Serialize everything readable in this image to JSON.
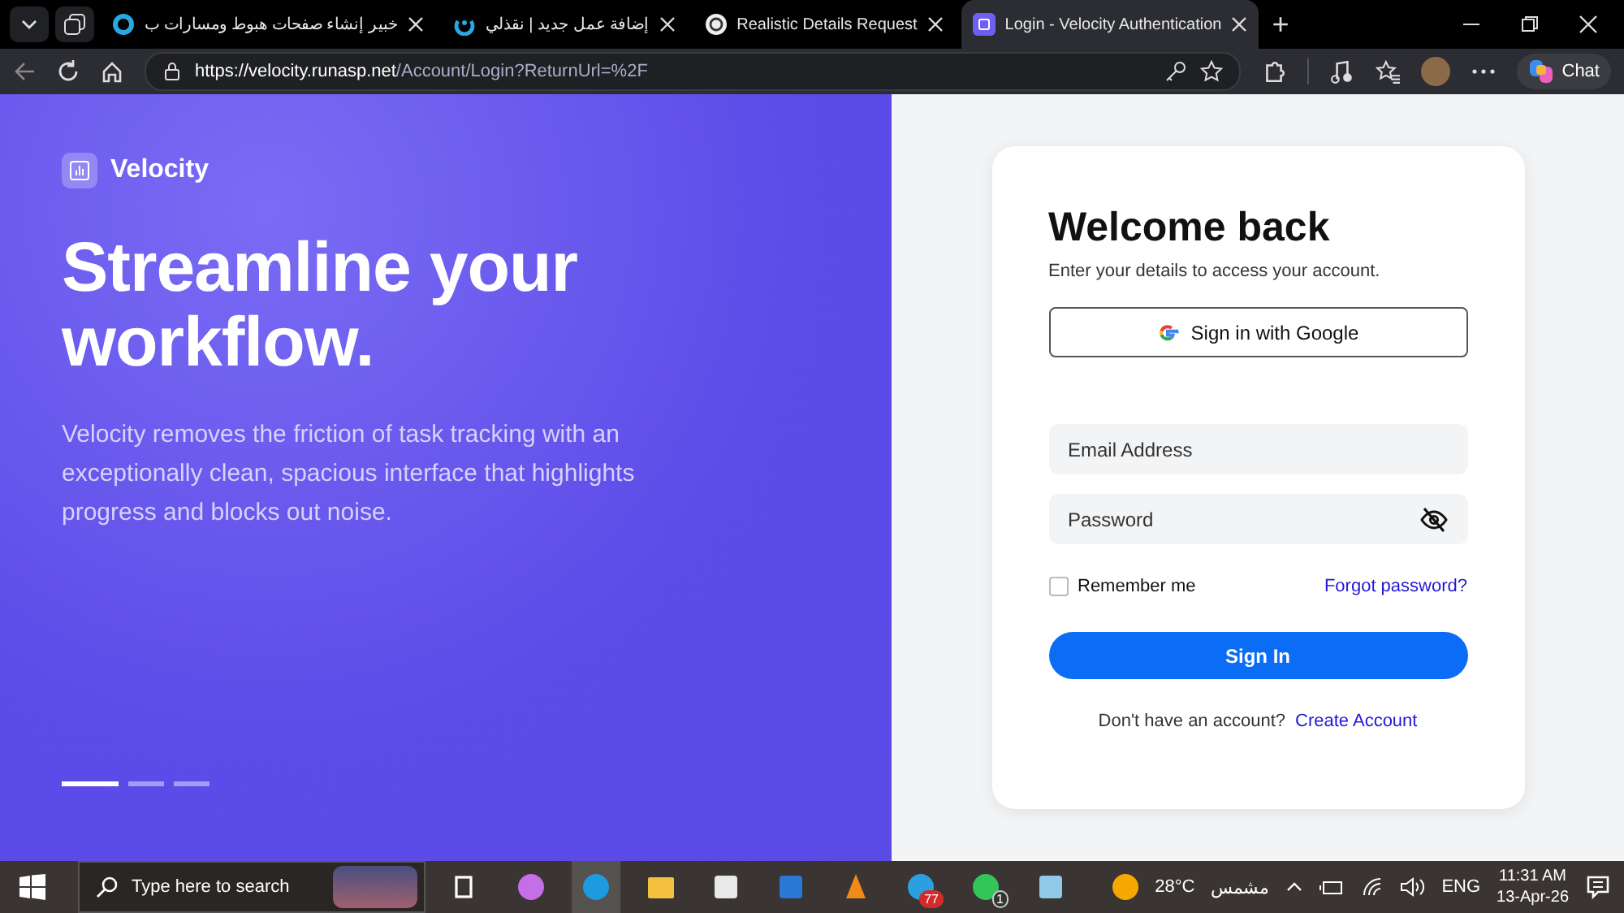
{
  "browser": {
    "tabs": [
      {
        "title": "خبير إنشاء صفحات هبوط ومسارات ب",
        "kind": "ring",
        "selected": false
      },
      {
        "title": "إضافة عمل جديد | نقذلي",
        "kind": "arc",
        "selected": false
      },
      {
        "title": "Realistic Details Request",
        "kind": "knot",
        "selected": false
      },
      {
        "title": "Login - Velocity Authentication",
        "kind": "app",
        "selected": true
      }
    ],
    "new_tab": "+",
    "url_host": "https://velocity.runasp.net",
    "url_path": "/Account/Login?ReturnUrl=%2F",
    "chat_label": "Chat"
  },
  "hero": {
    "brand": "Velocity",
    "headline": "Streamline your workflow.",
    "description": "Velocity removes the friction of task tracking with an exceptionally clean, spacious interface that highlights progress and blocks out noise.",
    "slides": [
      {
        "selected": true
      },
      {
        "selected": false
      },
      {
        "selected": false
      }
    ]
  },
  "login": {
    "title": "Welcome back",
    "subtitle": "Enter your details to access your account.",
    "google_button": "Sign in with Google",
    "email": {
      "placeholder": "Email Address"
    },
    "password": {
      "placeholder": "Password"
    },
    "remember": {
      "label": "Remember me",
      "checked": false
    },
    "forgot": "Forgot password?",
    "submit": "Sign In",
    "signup_prompt": "Don't have an account?",
    "signup_link": "Create Account"
  },
  "taskbar": {
    "search_placeholder": "Type here to search",
    "apps": [
      {
        "kind": "task-view",
        "selected": false
      },
      {
        "kind": "copilot",
        "selected": false
      },
      {
        "kind": "edge",
        "selected": true
      },
      {
        "kind": "folder",
        "selected": false
      },
      {
        "kind": "store",
        "selected": false
      },
      {
        "kind": "mail",
        "selected": false
      },
      {
        "kind": "cone",
        "selected": false
      },
      {
        "kind": "telegram",
        "selected": false,
        "badge": "77"
      },
      {
        "kind": "whatsapp",
        "selected": false,
        "badge": "1"
      },
      {
        "kind": "notepad",
        "selected": false
      }
    ],
    "temperature": "28°C",
    "weather": "مشمس",
    "language": "ENG",
    "time": "11:31 AM",
    "date": "13-Apr-26"
  }
}
